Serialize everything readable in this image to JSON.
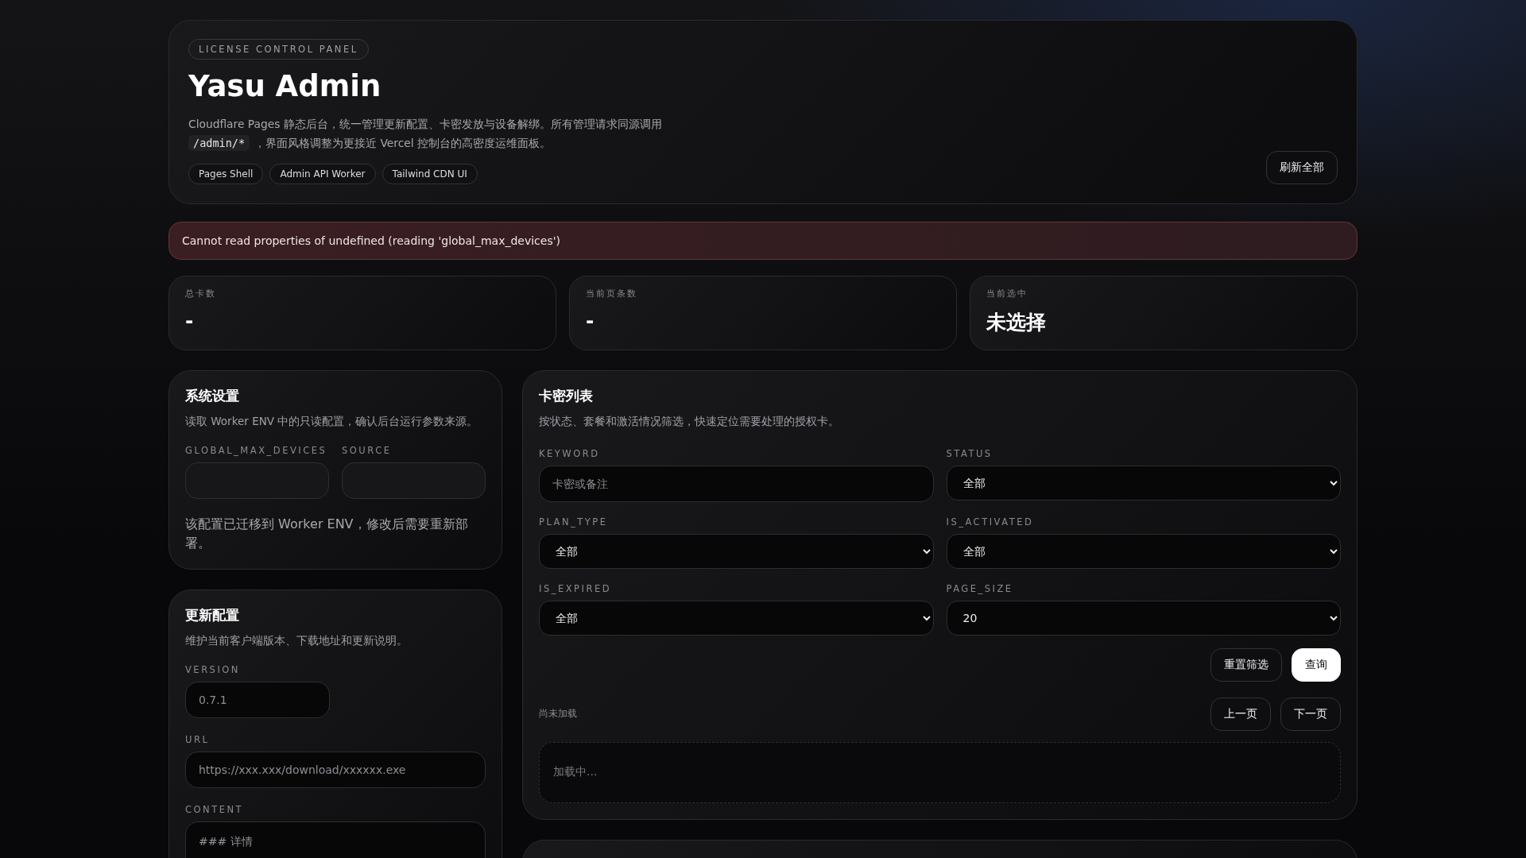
{
  "header": {
    "badge": "LICENSE CONTROL PANEL",
    "title": "Yasu Admin",
    "description": [
      {
        "kind": "text",
        "text": "Cloudflare Pages 静态后台，统一管理更新配置、卡密发放与设备解绑。所有管理请求同源调用"
      },
      {
        "kind": "code",
        "text": "/admin/*"
      },
      {
        "kind": "text",
        "text": "，界面风格调整为更接近 Vercel 控制台的高密度运维面板。"
      }
    ],
    "tags": [
      "Pages Shell",
      "Admin API Worker",
      "Tailwind CDN UI"
    ],
    "refresh_button": "刷新全部"
  },
  "error": "Cannot read properties of undefined (reading 'global_max_devices')",
  "stats": [
    {
      "label": "总卡数",
      "value": "-"
    },
    {
      "label": "当前页条数",
      "value": "-"
    },
    {
      "label": "当前选中",
      "value": "未选择"
    }
  ],
  "system_settings": {
    "title": "系统设置",
    "subtitle": "读取 Worker ENV 中的只读配置，确认后台运行参数来源。",
    "fields": [
      {
        "label": "GLOBAL_MAX_DEVICES"
      },
      {
        "label": "SOURCE"
      }
    ],
    "note": "该配置已迁移到 Worker ENV，修改后需要重新部署。"
  },
  "update_config": {
    "title": "更新配置",
    "subtitle": "维护当前客户端版本、下载地址和更新说明。",
    "fields": [
      {
        "label": "VERSION",
        "placeholder": "0.7.1",
        "kind": "short"
      },
      {
        "label": "URL",
        "placeholder": "https://xxx.xxx/download/xxxxxx.exe",
        "kind": "wide"
      },
      {
        "label": "CONTENT",
        "placeholder": "### 详情",
        "kind": "textarea"
      }
    ]
  },
  "card_list": {
    "title": "卡密列表",
    "subtitle": "按状态、套餐和激活情况筛选，快速定位需要处理的授权卡。",
    "filters": [
      {
        "label": "KEYWORD",
        "kind": "input",
        "placeholder": "卡密或备注"
      },
      {
        "label": "STATUS",
        "kind": "select",
        "value": "全部"
      },
      {
        "label": "PLAN_TYPE",
        "kind": "select",
        "value": "全部"
      },
      {
        "label": "IS_ACTIVATED",
        "kind": "select",
        "value": "全部"
      },
      {
        "label": "IS_EXPIRED",
        "kind": "select",
        "value": "全部"
      },
      {
        "label": "PAGE_SIZE",
        "kind": "select",
        "value": "20"
      }
    ],
    "actions": [
      {
        "label": "重置筛选",
        "primary": false
      },
      {
        "label": "查询",
        "primary": true
      }
    ],
    "status": "尚未加载",
    "pager": [
      "上一页",
      "下一页"
    ],
    "loading": "加载中..."
  }
}
